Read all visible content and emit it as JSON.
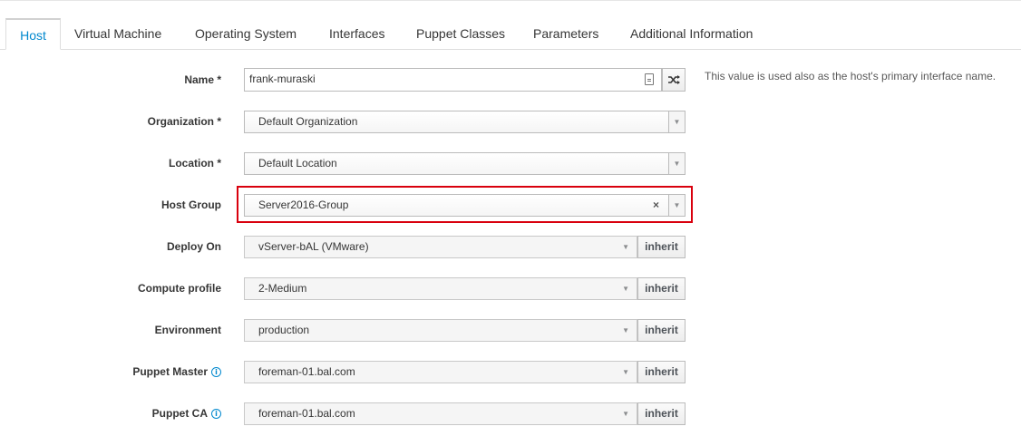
{
  "tabs": [
    {
      "label": "Host",
      "active": true
    },
    {
      "label": "Virtual Machine",
      "active": false
    },
    {
      "label": "Operating System",
      "active": false
    },
    {
      "label": "Interfaces",
      "active": false
    },
    {
      "label": "Puppet Classes",
      "active": false
    },
    {
      "label": "Parameters",
      "active": false
    },
    {
      "label": "Additional Information",
      "active": false
    }
  ],
  "form": {
    "name": {
      "label": "Name *",
      "value": "frank-muraski",
      "help": "This value is used also as the host's primary interface name."
    },
    "organization": {
      "label": "Organization *",
      "value": "Default Organization"
    },
    "location": {
      "label": "Location *",
      "value": "Default Location"
    },
    "host_group": {
      "label": "Host Group",
      "value": "Server2016-Group",
      "clear_glyph": "×"
    },
    "deploy_on": {
      "label": "Deploy On",
      "value": "vServer-bAL (VMware)",
      "button": "inherit"
    },
    "compute_profile": {
      "label": "Compute profile",
      "value": "2-Medium",
      "button": "inherit"
    },
    "environment": {
      "label": "Environment",
      "value": "production",
      "button": "inherit"
    },
    "puppet_master": {
      "label": "Puppet Master",
      "value": "foreman-01.bal.com",
      "button": "inherit"
    },
    "puppet_ca": {
      "label": "Puppet CA",
      "value": "foreman-01.bal.com",
      "button": "inherit"
    }
  },
  "icons": {
    "caret": "▼",
    "info": "i",
    "shuffle": "shuffle-icon",
    "copy": "copy-icon"
  },
  "colors": {
    "accent": "#0088ce",
    "highlight": "#d9000d"
  }
}
